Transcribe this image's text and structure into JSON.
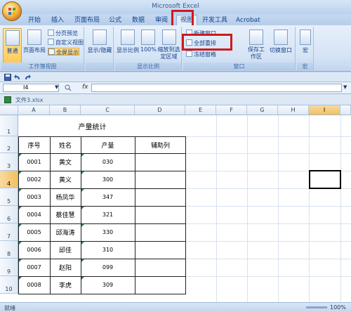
{
  "app": {
    "title": "Microsoft Excel"
  },
  "ribbon": {
    "tabs": [
      "开始",
      "插入",
      "页面布局",
      "公式",
      "数据",
      "审阅",
      "视图",
      "开发工具",
      "Acrobat"
    ],
    "active_tab": "视图",
    "workbook_views": {
      "normal": "普通",
      "page_layout": "页面布局",
      "page_break_preview": "分页预览",
      "custom_views": "自定义视图",
      "full_screen": "全屏显示",
      "group_label": "工作簿视图"
    },
    "show_hide": {
      "label": "显示/隐藏"
    },
    "zoom": {
      "zoom": "显示比例",
      "zoom_100": "100%",
      "zoom_to_selection": "缩放到选定区域",
      "group_label": "显示比例"
    },
    "window": {
      "new_window": "新建窗口",
      "arrange_all": "全部重排",
      "freeze_panes": "冻结窗格",
      "save_workspace": "保存工作区",
      "switch_windows": "切换窗口",
      "group_label": "窗口"
    },
    "macros": {
      "label": "宏",
      "group_label": "宏"
    }
  },
  "formula_bar": {
    "name_box": "I4",
    "fx": "fx",
    "value": ""
  },
  "document": {
    "filename": "文件3.xlsx"
  },
  "sheet": {
    "columns": [
      "A",
      "B",
      "C",
      "D",
      "E",
      "F",
      "G",
      "H",
      "I"
    ],
    "rows": [
      "1",
      "2",
      "3",
      "4",
      "5",
      "6",
      "7",
      "8",
      "9",
      "10"
    ],
    "selected_cell": "I4",
    "title": "产量统计",
    "headers": [
      "序号",
      "姓名",
      "产量",
      "辅助列"
    ],
    "data": [
      [
        "0001",
        "黄文",
        "030"
      ],
      [
        "0002",
        "黄义",
        "300"
      ],
      [
        "0003",
        "杨凤华",
        "347"
      ],
      [
        "0004",
        "蔡佳慧",
        "321"
      ],
      [
        "0005",
        "邱海涛",
        "330"
      ],
      [
        "0006",
        "邱佳",
        "310"
      ],
      [
        "0007",
        "赵阳",
        "099"
      ],
      [
        "0008",
        "李虎",
        "309"
      ]
    ]
  },
  "status": {
    "ready": "就绪",
    "zoom": "100%"
  },
  "colors": {
    "highlight": "#d0191c",
    "selection": "#f1c15f"
  }
}
